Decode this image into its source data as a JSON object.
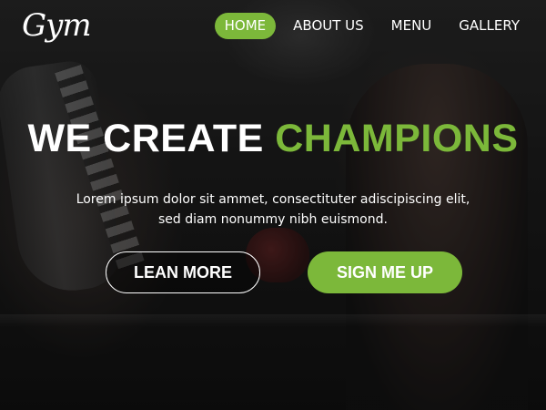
{
  "brand": {
    "logo_text": "Gym"
  },
  "nav": {
    "items": [
      {
        "label": "HOME",
        "active": true
      },
      {
        "label": "ABOUT US",
        "active": false
      },
      {
        "label": "MENU",
        "active": false
      },
      {
        "label": "GALLERY",
        "active": false
      }
    ]
  },
  "hero": {
    "headline_white": "WE CREATE",
    "headline_accent": "CHAMPIONS",
    "subtext_line1": "Lorem ipsum dolor sit ammet, consectituter adiscipiscing elit,",
    "subtext_line2": "sed diam nonummy nibh euismond.",
    "cta_secondary": "LEAN MORE",
    "cta_primary": "SIGN ME UP"
  },
  "colors": {
    "accent": "#7cb83a",
    "text": "#ffffff",
    "background": "#1a1a1a"
  }
}
